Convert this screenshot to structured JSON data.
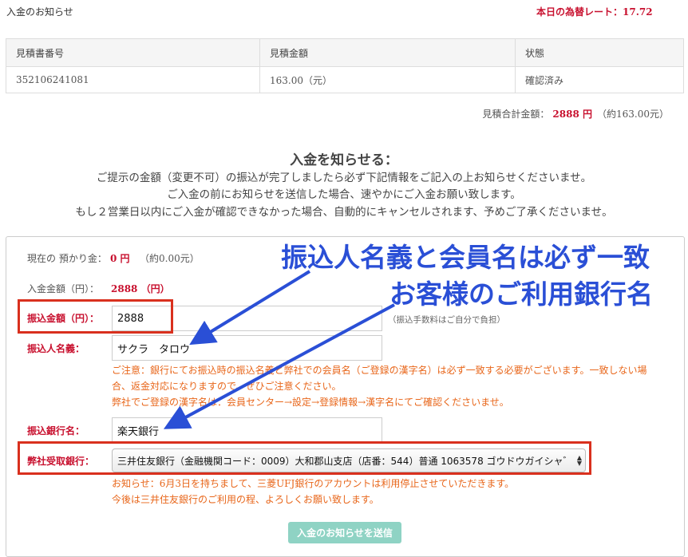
{
  "header": {
    "title": "入金のお知らせ",
    "rate_label": "本日の為替レート：",
    "rate_value": "17.72"
  },
  "quote_table": {
    "columns": [
      "見積書番号",
      "見積金額",
      "状態"
    ],
    "rows": [
      [
        "352106241081",
        "163.00（元）",
        "確認済み"
      ]
    ]
  },
  "total": {
    "label": "見積合計金額：",
    "amount": "2888",
    "unit": "円",
    "approx": "（約163.00元）"
  },
  "notice": {
    "heading": "入金を知らせる：",
    "lines": [
      "ご提示の金額（変更不可）の振込が完了しましたら必ず下記情報をご記入の上お知らせくださいませ。",
      "ご入金の前にお知らせを送信した場合、速やかにご入金お願い致します。",
      "もし２営業日以内にご入金が確認できなかった場合、自動的にキャンセルされます、予めご了承くださいませ。"
    ]
  },
  "form": {
    "deposit_label": "現在の 預かり金：",
    "deposit_value": "0 円",
    "deposit_approx": "（約0.00元）",
    "amount_label": "入金金額（円）：",
    "amount_value": "2888 （円）",
    "transfer_amount_label": "振込金額（円）：",
    "transfer_amount_value": "2888",
    "fee_hint": "（振込手数料はご自分で負担）",
    "transfer_name_label": "振込人名義：",
    "transfer_name_value": "サクラ　タロウ",
    "caution_lines": [
      "ご注意：銀行にてお振込時の振込名義と弊社での会員名（ご登録の漢字名）は必ず一致する必要がございます。一致しない場",
      "合、返金対応になりますので、ぜひご注意ください。",
      "弊社でご登録の漢字名は：会員センター→設定→登録情報→漢字名にてご確認くださいませ。"
    ],
    "bank_label": "振込銀行名：",
    "bank_value": "楽天銀行",
    "receiving_bank_label": "弊社受取銀行：",
    "receiving_bank_selected": "三井住友銀行（金融機関コード：0009）大和郡山支店（店番：544）普通 1063578 ゴウドウガイシャ゛",
    "notice_lines": [
      "お知らせ：6月3日を持ちまして、三菱UFJ銀行のアカウントは利用停止させていただきます。",
      "今後は三井住友銀行のご利用の程、よろしくお願い致します。"
    ],
    "submit_label": "入金のお知らせを送信"
  },
  "annotations": {
    "callout_1": "振込人名義と会員名は必ず一致",
    "callout_2": "お客様のご利用銀行名",
    "color": "#2a4fd6",
    "box_color": "#d9301e"
  }
}
